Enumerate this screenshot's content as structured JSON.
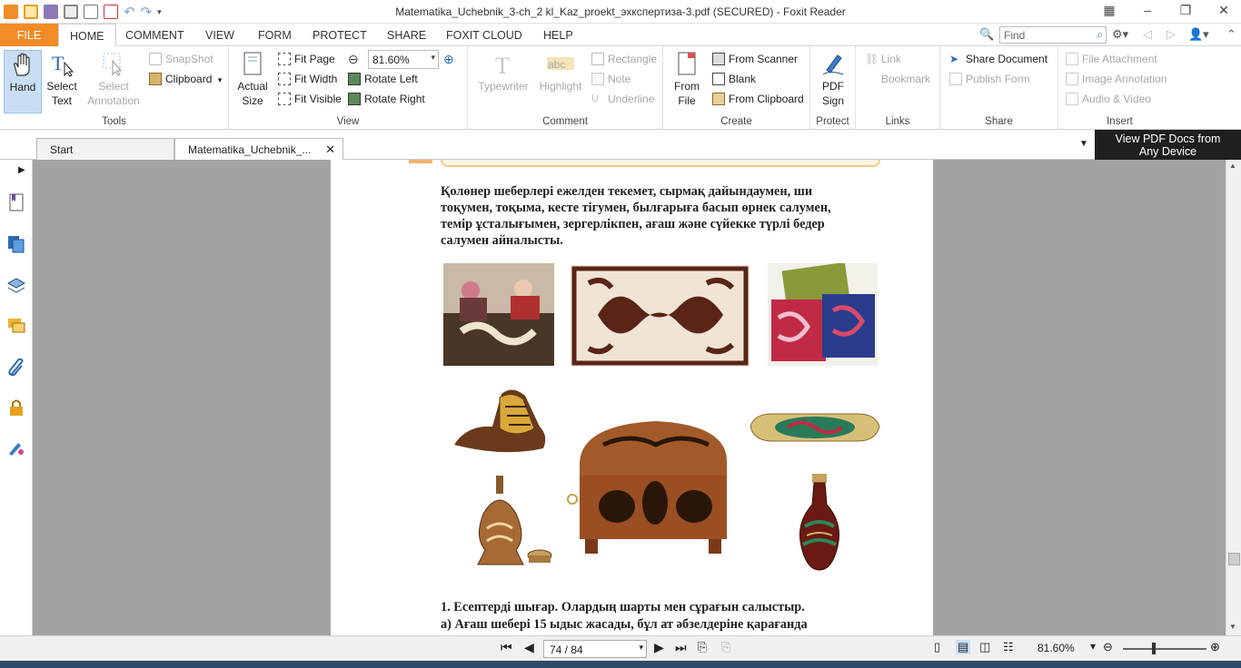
{
  "window": {
    "title": "Matematika_Uchebnik_3-ch_2 kl_Kaz_proekt_эхкспертиза-3.pdf (SECURED) - Foxit Reader"
  },
  "ribbon_tabs": [
    "FILE",
    "HOME",
    "COMMENT",
    "VIEW",
    "FORM",
    "PROTECT",
    "SHARE",
    "FOXIT CLOUD",
    "HELP"
  ],
  "find": {
    "placeholder": "Find"
  },
  "tools": {
    "label": "Tools",
    "hand": "Hand",
    "select_text": "Select Text",
    "select_annotation": "Select Annotation",
    "snapshot": "SnapShot",
    "clipboard": "Clipboard"
  },
  "view": {
    "label": "View",
    "actual_size": "Actual Size",
    "fit_page": "Fit Page",
    "fit_width": "Fit Width",
    "fit_visible": "Fit Visible",
    "zoom_value": "81.60%",
    "rotate_left": "Rotate Left",
    "rotate_right": "Rotate Right"
  },
  "comment": {
    "label": "Comment",
    "typewriter": "Typewriter",
    "highlight": "Highlight",
    "rectangle": "Rectangle",
    "note": "Note",
    "underline": "Underline"
  },
  "create": {
    "label": "Create",
    "from_file": "From File",
    "from_scanner": "From Scanner",
    "blank": "Blank",
    "from_clipboard": "From Clipboard"
  },
  "protect": {
    "label": "Protect",
    "pdf_sign": "PDF Sign"
  },
  "links": {
    "label": "Links",
    "link": "Link",
    "bookmark": "Bookmark"
  },
  "share": {
    "label": "Share",
    "share_document": "Share Document",
    "publish_form": "Publish Form"
  },
  "insert": {
    "label": "Insert",
    "file_attachment": "File Attachment",
    "image_annotation": "Image Annotation",
    "audio_video": "Audio & Video"
  },
  "doc_tabs": [
    "Start",
    "Matematika_Uchebnik_..."
  ],
  "promo": {
    "line1": "View PDF Docs from",
    "line2": "Any Device"
  },
  "page_content": {
    "paragraph_lines": [
      "Қолөнер шеберлері ежелден текемет, сырмақ дайындаумен, ши",
      "тоқумен, тоқыма, кесте тігумен, былғарыға басып өрнек салумен,",
      "темір ұсталығымен, зергерлікпен, ағаш және сүйекке түрлі бедер",
      "салумен айналысты."
    ],
    "task_line1": "1. Есептерді шығар. Олардың шарты мен сұрағын салыстыр.",
    "task_line2": "а) Ағаш шебері 15 ыдыс жасады, бұл ат әбзелдеріне қарағанда"
  },
  "status": {
    "page_indicator": "74 / 84",
    "zoom": "81.60%"
  },
  "colors": {
    "file_tab": "#f28c26",
    "doc_background": "#a3a3a3",
    "selected_tool": "#c9def5"
  }
}
